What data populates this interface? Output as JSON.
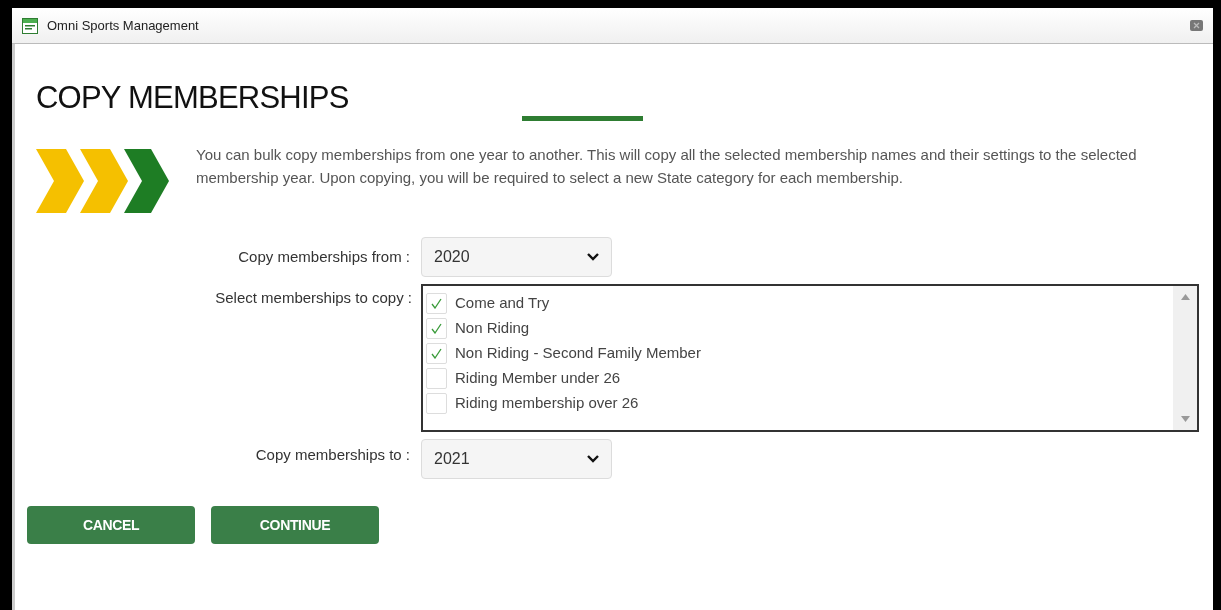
{
  "window": {
    "title": "Omni Sports Management"
  },
  "heading": "COPY MEMBERSHIPS",
  "intro": "You can bulk copy memberships from one year to another. This will copy all the selected membership names and their settings to the selected membership year. Upon copying, you will be required to select a new State category for each membership.",
  "from": {
    "label": "Copy memberships from :",
    "value": "2020"
  },
  "select": {
    "label": "Select memberships to copy :",
    "items": [
      {
        "label": "Come and Try",
        "checked": true
      },
      {
        "label": "Non Riding",
        "checked": true
      },
      {
        "label": "Non Riding - Second Family Member",
        "checked": true
      },
      {
        "label": "Riding Member under 26",
        "checked": false
      },
      {
        "label": "Riding membership over 26",
        "checked": false
      }
    ]
  },
  "to": {
    "label": "Copy memberships to :",
    "value": "2021"
  },
  "buttons": [
    "CANCEL",
    "CONTINUE"
  ]
}
